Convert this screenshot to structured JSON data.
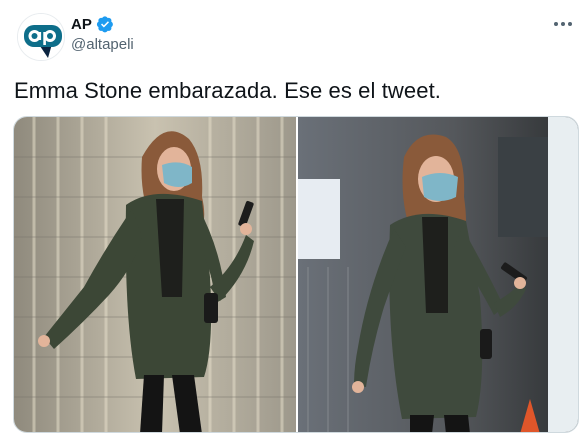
{
  "tweet": {
    "author": {
      "display_name": "AP",
      "handle": "@altapeli",
      "avatar_letters": "ap",
      "verified": true
    },
    "more_icon": "more-horizontal-icon",
    "text": "Emma Stone embarazada. Ese es el tweet.",
    "media": [
      {
        "label": "photo-1"
      },
      {
        "label": "photo-2"
      }
    ]
  },
  "colors": {
    "accent": "#1d9bf0",
    "avatar_brand": "#0e6e8a",
    "avatar_dark": "#0b2440",
    "text_primary": "#0f1419",
    "text_secondary": "#536471"
  }
}
